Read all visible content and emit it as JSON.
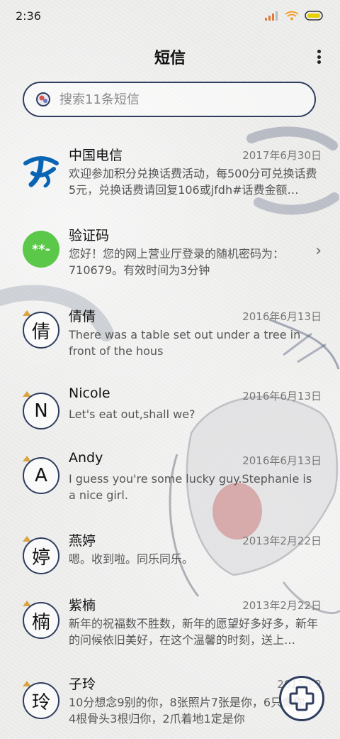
{
  "status_bar": {
    "time": "2:36",
    "icons": [
      "signal-icon",
      "wifi-icon",
      "battery-icon"
    ]
  },
  "header": {
    "title": "短信",
    "menu_icon": "more-vertical-icon"
  },
  "search": {
    "placeholder": "搜索11条短信",
    "value": ""
  },
  "threads": [
    {
      "name": "中国电信",
      "date": "2017年6月30日",
      "preview": "欢迎参加积分兑换话费活动，每500分可兑换话费5元，兑换话费请回复106或jfdh#话费金额…",
      "avatar": "china-telecom-logo"
    },
    {
      "name": "验证码",
      "date": "",
      "preview": "您好！您的网上营业厅登录的随机密码为：710679。有效时间为3分钟",
      "avatar_text": "**-"
    },
    {
      "name": "倩倩",
      "date": "2016年6月13日",
      "preview": "There was a table set out under a tree in front of the hous",
      "avatar_text": "倩"
    },
    {
      "name": "Nicole",
      "date": "2016年6月13日",
      "preview": "Let's eat out,shall we?",
      "avatar_text": "N"
    },
    {
      "name": "Andy",
      "date": "2016年6月13日",
      "preview": "I guess you're some lucky guy.Stephanie is a nice girl.",
      "avatar_text": "A"
    },
    {
      "name": "燕婷",
      "date": "2013年2月22日",
      "preview": "嗯。收到啦。同乐同乐。",
      "avatar_text": "婷"
    },
    {
      "name": "紫楠",
      "date": "2013年2月22日",
      "preview": "新年的祝福数不胜数，新年的愿望好多好多，新年的问候依旧美好，在这个温馨的时刻，送上…",
      "avatar_text": "楠"
    },
    {
      "name": "子玲",
      "date": "2013年2",
      "preview": "10分想念9别的你，8张照片7张是你，6只像你，4根骨头3根归你，2爪着地1定是你",
      "avatar_text": "玲"
    }
  ],
  "fab": {
    "icon": "plus-icon"
  },
  "colors": {
    "accent": "#2f3d5f",
    "telecom_blue": "#0a64b4",
    "verify_green": "#5bc84a"
  }
}
